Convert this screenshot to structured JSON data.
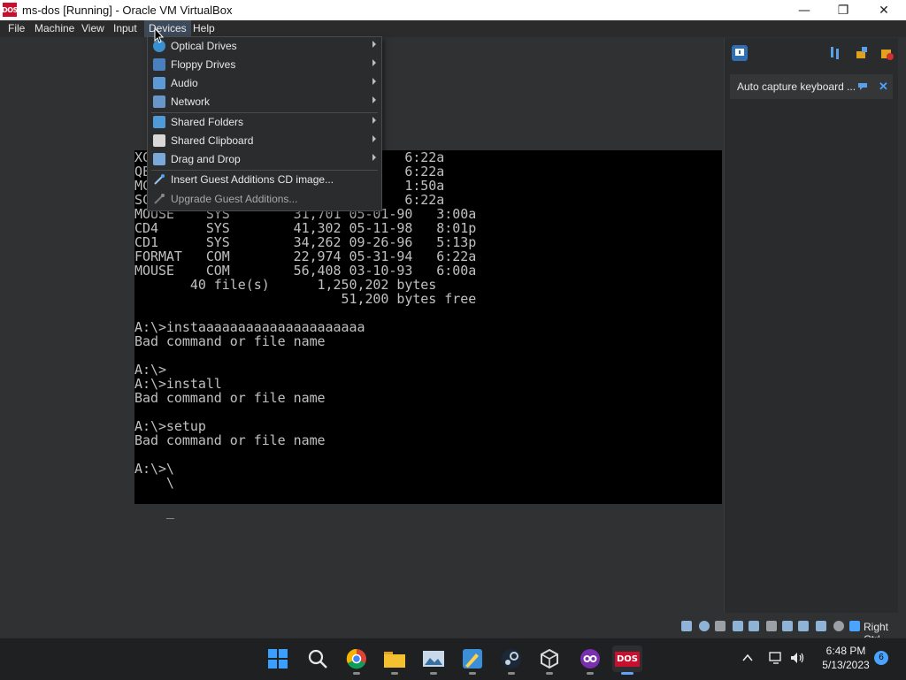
{
  "window": {
    "title": "ms-dos [Running] - Oracle VM VirtualBox",
    "app_icon_text": "DOS",
    "minimize_glyph": "—",
    "maximize_glyph": "❐",
    "close_glyph": "✕"
  },
  "menubar": {
    "items": [
      {
        "label": "File"
      },
      {
        "label": "Machine"
      },
      {
        "label": "View"
      },
      {
        "label": "Input"
      },
      {
        "label": "Devices"
      },
      {
        "label": "Help"
      }
    ]
  },
  "devices_menu": {
    "items": [
      {
        "label": "Optical Drives",
        "icon": "optical-drive-icon",
        "submenu": true
      },
      {
        "label": "Floppy Drives",
        "icon": "floppy-icon",
        "submenu": true
      },
      {
        "label": "Audio",
        "icon": "audio-icon",
        "submenu": true
      },
      {
        "label": "Network",
        "icon": "network-icon",
        "submenu": true
      },
      {
        "label": "Shared Folders",
        "icon": "shared-folder-icon",
        "submenu": true
      },
      {
        "label": "Shared Clipboard",
        "icon": "clipboard-icon",
        "submenu": true
      },
      {
        "label": "Drag and Drop",
        "icon": "drag-drop-icon",
        "submenu": true
      },
      {
        "label": "Insert Guest Additions CD image...",
        "icon": "guest-additions-icon",
        "submenu": false
      },
      {
        "label": "Upgrade Guest Additions...",
        "icon": "upgrade-icon",
        "submenu": false,
        "disabled": true
      }
    ]
  },
  "terminal": {
    "lines": [
      "XC                         1-94   6:22a",
      "QE                         1-94   6:22a",
      "MC                         1-97   1:50a",
      "SC                         1-94   6:22a",
      "MOUSE    SYS        31,701 05-01-90   3:00a",
      "CD4      SYS        41,302 05-11-98   8:01p",
      "CD1      SYS        34,262 09-26-96   5:13p",
      "FORMAT   COM        22,974 05-31-94   6:22a",
      "MOUSE    COM        56,408 03-10-93   6:00a",
      "       40 file(s)      1,250,202 bytes",
      "                          51,200 bytes free",
      "",
      "A:\\>instaaaaaaaaaaaaaaaaaaaaa",
      "Bad command or file name",
      "",
      "A:\\>",
      "A:\\>install",
      "Bad command or file name",
      "",
      "A:\\>setup",
      "Bad command or file name",
      "",
      "A:\\>\\",
      "    \\",
      "",
      "    _"
    ]
  },
  "side_panel": {
    "notification_text": "Auto capture keyboard ..."
  },
  "statusbar": {
    "host_key": "Right Ctrl"
  },
  "taskbar": {
    "apps": [
      {
        "name": "start",
        "icon": "windows-start-icon"
      },
      {
        "name": "search",
        "icon": "search-icon"
      },
      {
        "name": "chrome",
        "icon": "chrome-icon",
        "running": true
      },
      {
        "name": "file-explorer",
        "icon": "folder-icon",
        "running": true
      },
      {
        "name": "photos",
        "icon": "photos-icon",
        "running": true
      },
      {
        "name": "paint",
        "icon": "paint-icon",
        "running": true
      },
      {
        "name": "steam",
        "icon": "steam-icon",
        "running": true
      },
      {
        "name": "virtualbox",
        "icon": "virtualbox-icon",
        "running": true
      },
      {
        "name": "app-infinity",
        "icon": "infinity-icon",
        "running": true
      },
      {
        "name": "dos",
        "icon": "dos-icon",
        "running": true,
        "active": true,
        "text": "DOS"
      }
    ],
    "clock_time": "6:48 PM",
    "clock_date": "5/13/2023",
    "notification_count": "6"
  }
}
